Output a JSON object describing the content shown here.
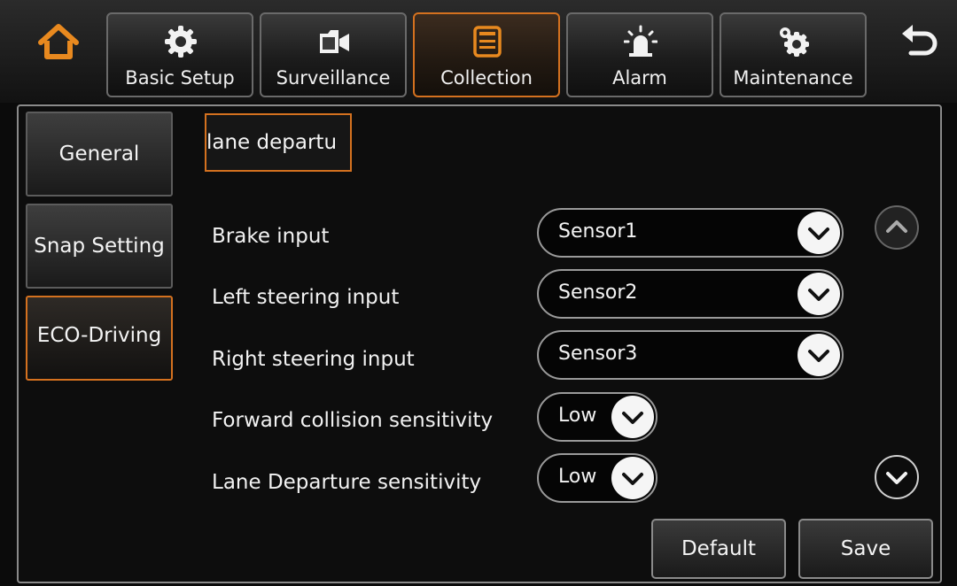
{
  "header": {
    "tabs": [
      {
        "label": "Basic Setup",
        "icon": "gear-icon"
      },
      {
        "label": "Surveillance",
        "icon": "video-camera-icon"
      },
      {
        "label": "Collection",
        "icon": "document-icon"
      },
      {
        "label": "Alarm",
        "icon": "siren-icon"
      },
      {
        "label": "Maintenance",
        "icon": "gears-icon"
      }
    ],
    "active_tab": "Collection",
    "home_icon": "home-icon",
    "back_icon": "back-arrow-icon"
  },
  "sidebar": {
    "items": [
      {
        "label": "General"
      },
      {
        "label": "Snap Setting"
      },
      {
        "label": "ECO-Driving"
      }
    ],
    "active_item": "ECO-Driving"
  },
  "main": {
    "subtab_label": "lane departu",
    "rows": [
      {
        "label": "Brake input",
        "value": "Sensor1"
      },
      {
        "label": "Left steering input",
        "value": "Sensor2"
      },
      {
        "label": "Right steering input",
        "value": "Sensor3"
      },
      {
        "label": "Forward collision sensitivity",
        "value": "Low"
      },
      {
        "label": "Lane Departure sensitivity",
        "value": "Low"
      }
    ]
  },
  "buttons": {
    "default_label": "Default",
    "save_label": "Save"
  },
  "colors": {
    "accent": "#d4711f",
    "background": "#0b0b0b"
  }
}
